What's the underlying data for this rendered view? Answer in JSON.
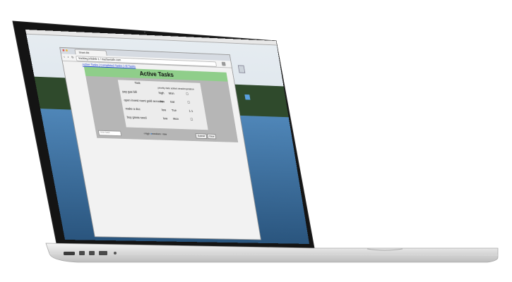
{
  "browser": {
    "tab_title": "Shark Bit",
    "address": "tracking.infolink-1 / mazlaesafe.com"
  },
  "app": {
    "nav_links": [
      "Active Tasks",
      "Completed Tasks",
      "All Tasks"
    ],
    "page_title": "Active Tasks",
    "table_header_task": "Task",
    "table_header_sort": "priority  date added  dead/expiration",
    "tasks": [
      {
        "name": "pay gas bill",
        "priority": "high",
        "date": "Mon",
        "mark": "☐"
      },
      {
        "name": "open invest ment gold account",
        "priority": "low",
        "date": "Sat",
        "mark": "☐"
      },
      {
        "name": "make a doc",
        "priority": "low",
        "date": "Tue",
        "mark": "1.1"
      },
      {
        "name": "buy grass-seed",
        "priority": "low",
        "date": "Mon",
        "mark": "☐"
      }
    ],
    "new_task_placeholder": "new task",
    "priority_options": [
      "high",
      "medium",
      "low"
    ],
    "submit_label": "Submit",
    "clear_label": "Clear"
  },
  "colors": {
    "title_band": "#8fce8a",
    "panel": "#b6b6b6",
    "link": "#1a3fd6",
    "desktop_water": "#3a6a96",
    "desktop_hills": "#2d4a2a"
  }
}
